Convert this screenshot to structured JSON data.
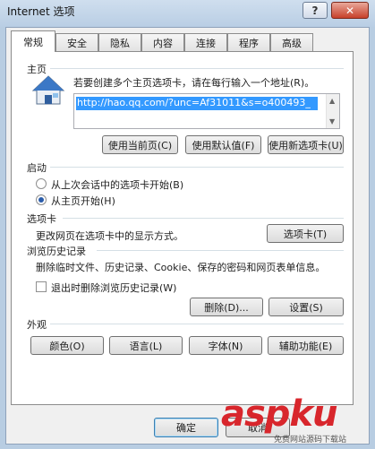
{
  "window": {
    "title": "Internet 选项",
    "help_label": "?",
    "close_label": "✕"
  },
  "tabs": [
    {
      "label": "常规",
      "active": true
    },
    {
      "label": "安全"
    },
    {
      "label": "隐私"
    },
    {
      "label": "内容"
    },
    {
      "label": "连接"
    },
    {
      "label": "程序"
    },
    {
      "label": "高级"
    }
  ],
  "home": {
    "section_label": "主页",
    "description": "若要创建多个主页选项卡，请在每行输入一个地址(R)。",
    "url": "http://hao.qq.com/?unc=Af31011&s=o400493_",
    "btn_current": "使用当前页(C)",
    "btn_default": "使用默认值(F)",
    "btn_new_tab": "使用新选项卡(U)"
  },
  "startup": {
    "section_label": "启动",
    "option_last_session": "从上次会话中的选项卡开始(B)",
    "option_home": "从主页开始(H)"
  },
  "tabs_section": {
    "section_label": "选项卡",
    "description": "更改网页在选项卡中的显示方式。",
    "button": "选项卡(T)"
  },
  "history": {
    "section_label": "浏览历史记录",
    "description": "删除临时文件、历史记录、Cookie、保存的密码和网页表单信息。",
    "checkbox_label": "退出时删除浏览历史记录(W)",
    "btn_delete": "删除(D)...",
    "btn_settings": "设置(S)"
  },
  "appearance": {
    "section_label": "外观",
    "btn_colors": "颜色(O)",
    "btn_languages": "语言(L)",
    "btn_fonts": "字体(N)",
    "btn_accessibility": "辅助功能(E)"
  },
  "footer": {
    "ok": "确定",
    "cancel": "取消"
  },
  "watermark": {
    "brand": "aspku",
    "tagline": "免费网站源码下载站"
  },
  "colors": {
    "accent": "#3399ff",
    "watermark_red": "#d8262c"
  }
}
